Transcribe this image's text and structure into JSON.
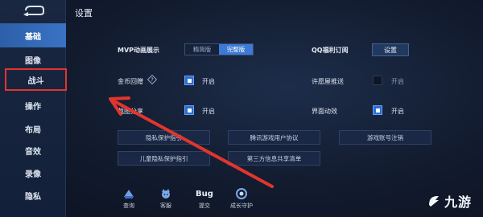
{
  "header": {
    "title": "设置"
  },
  "sidebar": {
    "items": [
      {
        "label": "基础",
        "active": true
      },
      {
        "label": "图像"
      },
      {
        "label": "战斗",
        "highlighted": true
      },
      {
        "label": "操作"
      },
      {
        "label": "布局"
      },
      {
        "label": "音效"
      },
      {
        "label": "录像"
      },
      {
        "label": "隐私"
      }
    ]
  },
  "settings": {
    "mvp": {
      "label": "MVP动画展示",
      "options": [
        "精简版",
        "完整版"
      ],
      "selected": "完整版"
    },
    "qq_sub": {
      "label": "QQ福利订阅",
      "button": "设置"
    },
    "gold_recall": {
      "label": "金币回赠",
      "state_label": "开启",
      "checked": true
    },
    "permission_push": {
      "label": "许愿屋推送",
      "state_label": "开启",
      "checked": false
    },
    "battle_share": {
      "label": "截图分享",
      "state_label": "开启",
      "checked": true
    },
    "ui_animation": {
      "label": "界面动效",
      "state_label": "开启",
      "checked": true
    }
  },
  "links": {
    "privacy_guide": "隐私保护指引",
    "user_agreement": "腾讯游戏用户协议",
    "account_cancel": "游戏账号注销",
    "child_privacy": "儿童隐私保护指引",
    "third_party": "第三方信息共享清单"
  },
  "bottom": {
    "query": "查询",
    "service": "客服",
    "bug": "提交",
    "bug_icon": "Bug",
    "guardian": "成长守护"
  },
  "colors": {
    "accent": "#3c7ad6",
    "highlight": "#e2352e",
    "arrow": "#e2352e"
  },
  "watermark": {
    "text": "九游"
  }
}
